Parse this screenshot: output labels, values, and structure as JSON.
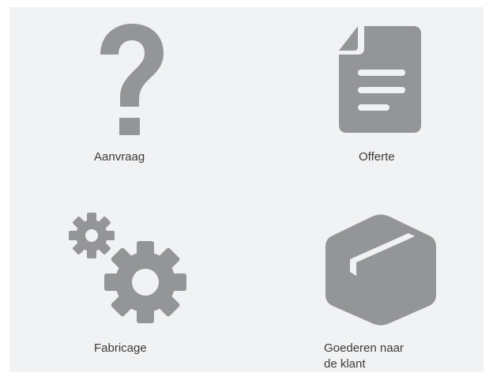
{
  "steps": [
    {
      "id": "aanvraag",
      "label": "Aanvraag",
      "icon": "question-mark-icon"
    },
    {
      "id": "offerte",
      "label": "Offerte",
      "icon": "document-icon"
    },
    {
      "id": "fabricage",
      "label": "Fabricage",
      "icon": "gears-icon"
    },
    {
      "id": "goederen",
      "label_line1": "Goederen naar",
      "label_line2": "de klant",
      "icon": "package-box-icon"
    }
  ],
  "colors": {
    "icon": "#949596",
    "panel_background": "#f1f2f4",
    "text": "#3a3a3a"
  }
}
